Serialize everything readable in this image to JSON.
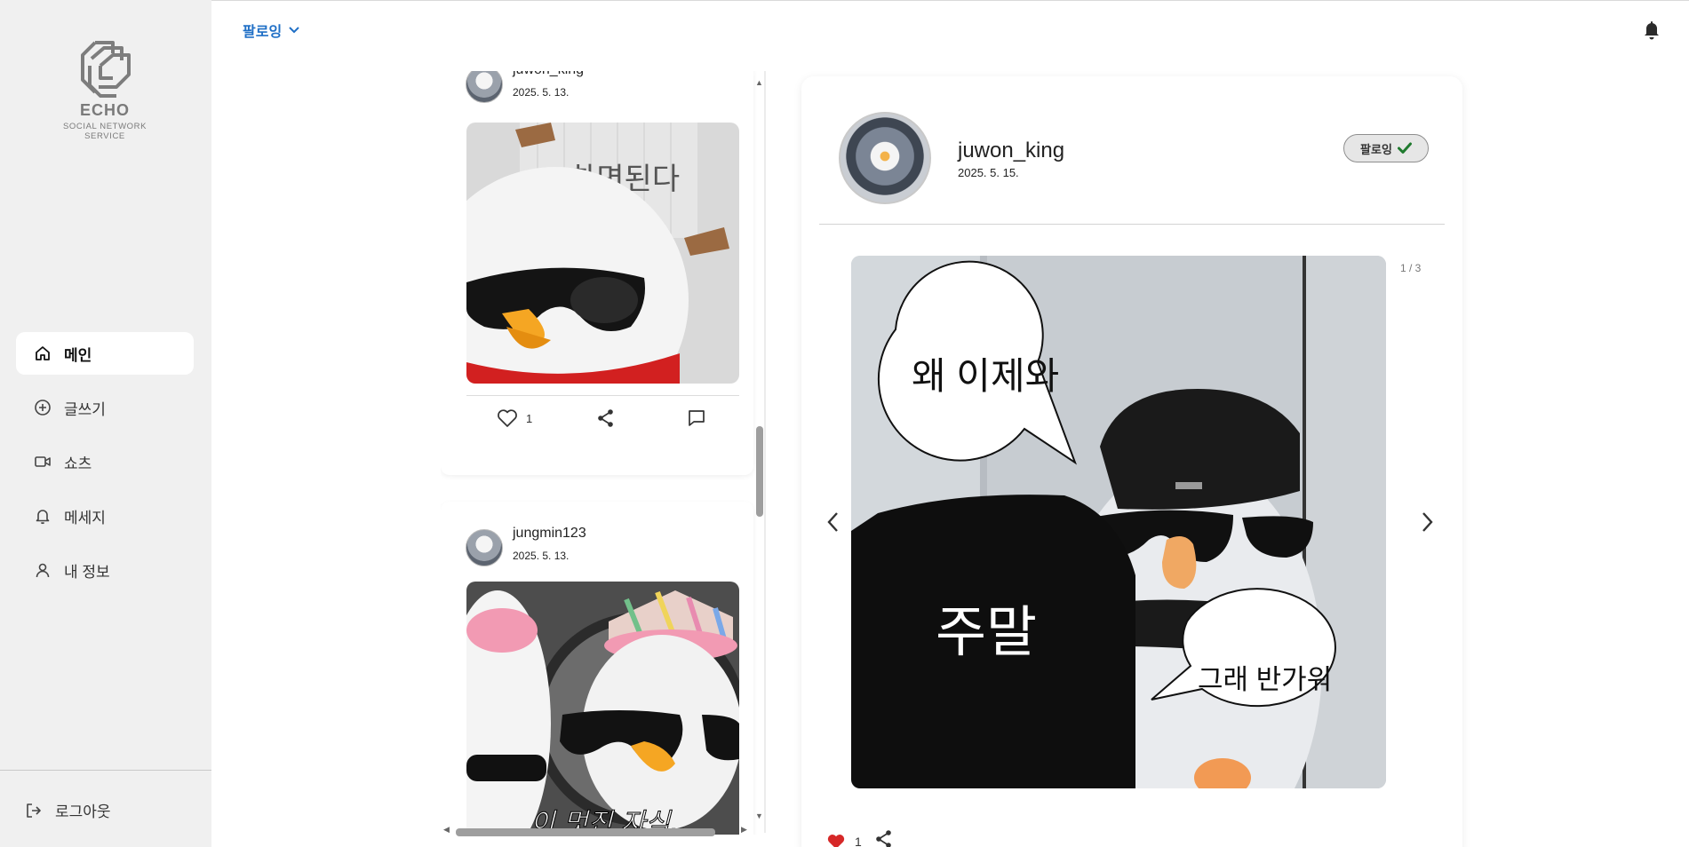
{
  "sidebar": {
    "logo": {
      "title": "ECHO",
      "subtitle": "SOCIAL NETWORK SERVICE"
    },
    "items": [
      {
        "label": "메인",
        "icon": "home-icon",
        "active": true
      },
      {
        "label": "글쓰기",
        "icon": "plus-circle-icon",
        "active": false
      },
      {
        "label": "쇼츠",
        "icon": "video-icon",
        "active": false
      },
      {
        "label": "메세지",
        "icon": "bell-outline-icon",
        "active": false
      },
      {
        "label": "내 정보",
        "icon": "user-icon",
        "active": false
      }
    ],
    "logout_label": "로그아웃"
  },
  "header": {
    "feed_filter_label": "팔로잉",
    "notification_icon": "bell-icon"
  },
  "feed": {
    "posts": [
      {
        "username": "juwon_king",
        "date": "2025. 5. 13.",
        "image_text": "하면된다",
        "likes": "1"
      },
      {
        "username": "jungmin123",
        "date": "2025. 5. 13.",
        "image_caption": "이 멋진 자식.."
      }
    ]
  },
  "detail": {
    "username": "juwon_king",
    "date": "2025. 5. 15.",
    "follow_label": "팔로잉",
    "image_counter": "1 / 3",
    "bubble_1": "왜 이제와",
    "bubble_2": "그래 반가워",
    "image_caption": "주말",
    "likes": "1",
    "liked_color": "#d62828"
  },
  "colors": {
    "accent": "#1f6fc6",
    "sidebar_bg": "#f0f0f0"
  }
}
